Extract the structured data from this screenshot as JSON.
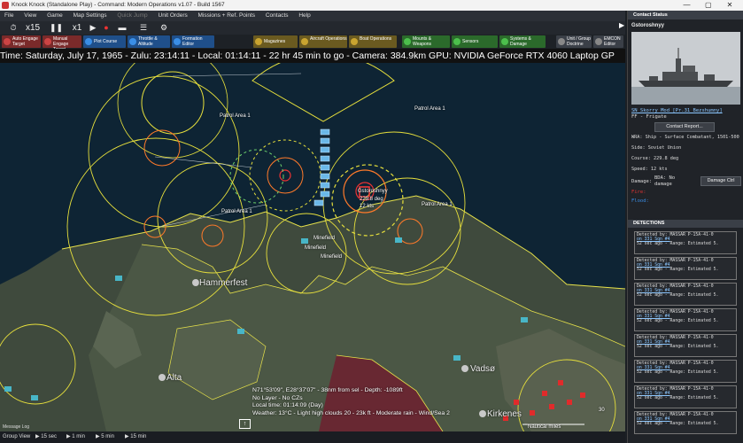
{
  "window": {
    "title": "Knock Knock (Standalone Play) - Command: Modern Operations v1.07 - Build 1567",
    "minimize": "—",
    "maximize": "▢",
    "close": "✕"
  },
  "menu": [
    "File",
    "View",
    "Game",
    "Map Settings",
    "Quick Jump",
    "Unit Orders",
    "Missions + Ref. Points",
    "Contacts",
    "Help"
  ],
  "toolbar": {
    "compression": "x15",
    "step": "x1"
  },
  "toolbar2": [
    {
      "label": "Auto Engage Target",
      "color": "#7a2a2a",
      "icon": "#c44"
    },
    {
      "label": "Manual Engage Target",
      "color": "#7a2a2a",
      "icon": "#c44"
    },
    {
      "label": "Plot Course",
      "color": "#1f4f8a",
      "icon": "#3a8ee6"
    },
    {
      "label": "Throttle & Altitude",
      "color": "#1f4f8a",
      "icon": "#3a8ee6"
    },
    {
      "label": "Formation Editor",
      "color": "#1f4f8a",
      "icon": "#3a8ee6"
    },
    {
      "label": "Magazines",
      "color": "#6a5a20",
      "icon": "#c9a430"
    },
    {
      "label": "Aircraft Operations",
      "color": "#6a5a20",
      "icon": "#c9a430"
    },
    {
      "label": "Boat Operations",
      "color": "#6a5a20",
      "icon": "#c9a430"
    },
    {
      "label": "Mounts & Weapons",
      "color": "#2b6a2b",
      "icon": "#4cbf4c"
    },
    {
      "label": "Sensors",
      "color": "#2b6a2b",
      "icon": "#4cbf4c"
    },
    {
      "label": "Systems & Damage",
      "color": "#2b6a2b",
      "icon": "#4cbf4c"
    },
    {
      "label": "Unit / Group Doctrine",
      "color": "#3a3f47",
      "icon": "#888"
    },
    {
      "label": "EMCON Editor",
      "color": "#3a3f47",
      "icon": "#888"
    }
  ],
  "timebar": "Time: Saturday, July 17, 1965 - Zulu: 23:14:11 - Local: 01:14:11 - 22 hr 45 min to go - Camera: 384.9km GPU: NVIDIA GeForce RTX 4060 Laptop GP",
  "map": {
    "patrol_labels": [
      "Patrol Area 1",
      "Patrol Area 1",
      "Patrol Area 1",
      "Patrol Area 1",
      "Patrol Area 1"
    ],
    "cities": [
      "Hammerfest",
      "Alta",
      "Vadsø",
      "Kirkenes"
    ],
    "minefields": [
      "Minefield",
      "Minefield",
      "Minefield",
      "Minefield"
    ],
    "selected_unit": {
      "name": "Gstoroshnyy",
      "speed": "229.8 deg",
      "kts": "12 kts"
    },
    "coords": [
      "N71°53'09\", E28°37'07\" - 38nm from sel - Depth: -1089ft",
      "No Layer - No CZs",
      "Local time: 01:14:09 (Day)",
      "Weather: 13°C - Light high clouds 20 - 23k ft - Moderate rain - Wind/Sea 2"
    ],
    "scale": "Nautical miles",
    "scale_value": "30"
  },
  "bottom": {
    "message_log": "Message Log",
    "group_view": "Group View",
    "steps": [
      "15 sec",
      "1 min",
      "5 min",
      "15 min"
    ]
  },
  "side": {
    "header": "Contact Status",
    "unit_name": "Gstoroshnyy",
    "class_link": "SN Skorry Mod [Pr.31 Bezshumny]",
    "unit_type": "FF - Frigate",
    "report_btn": "Contact Report...",
    "info": [
      "WRA: Ship - Surface Combatant, 1501-500",
      "Side: Soviet Union",
      "Course: 229.8 deg",
      "Speed: 12 kts"
    ],
    "damage_label": "Damage:",
    "bda": "BDA: No damage",
    "damage_ctrl": "Damage Ctrl",
    "fire": "Fire:",
    "flood": "Flood:",
    "detections_header": "DETECTIONS",
    "detections": [
      {
        "by": "Detected by: MASSAR P-15A-41-0",
        "on": "on 331 Sqn #4",
        "time": "52 sec ago - Range: Estimated 5."
      },
      {
        "by": "Detected by: MASSAR P-15A-41-0",
        "on": "on 331 Sqn #4",
        "time": "52 sec ago - Range: Estimated 5."
      },
      {
        "by": "Detected by: MASSAR P-15A-41-0",
        "on": "on 331 Sqn #4",
        "time": "52 sec ago - Range: Estimated 5."
      },
      {
        "by": "Detected by: MASSAR P-15A-41-0",
        "on": "on 331 Sqn #4",
        "time": "52 sec ago - Range: Estimated 5."
      },
      {
        "by": "Detected by: MASSAR P-15A-41-0",
        "on": "on 331 Sqn #4",
        "time": "52 sec ago - Range: Estimated 5."
      },
      {
        "by": "Detected by: MASSAR P-15A-41-0",
        "on": "on 331 Sqn #4",
        "time": "52 sec ago - Range: Estimated 5."
      },
      {
        "by": "Detected by: MASSAR P-15A-41-0",
        "on": "on 331 Sqn #4",
        "time": "52 sec ago - Range: Estimated 5."
      },
      {
        "by": "Detected by: MASSAR P-15A-41-0",
        "on": "on 331 Sqn #4",
        "time": "52 sec ago - Range: Estimated 5."
      }
    ]
  }
}
